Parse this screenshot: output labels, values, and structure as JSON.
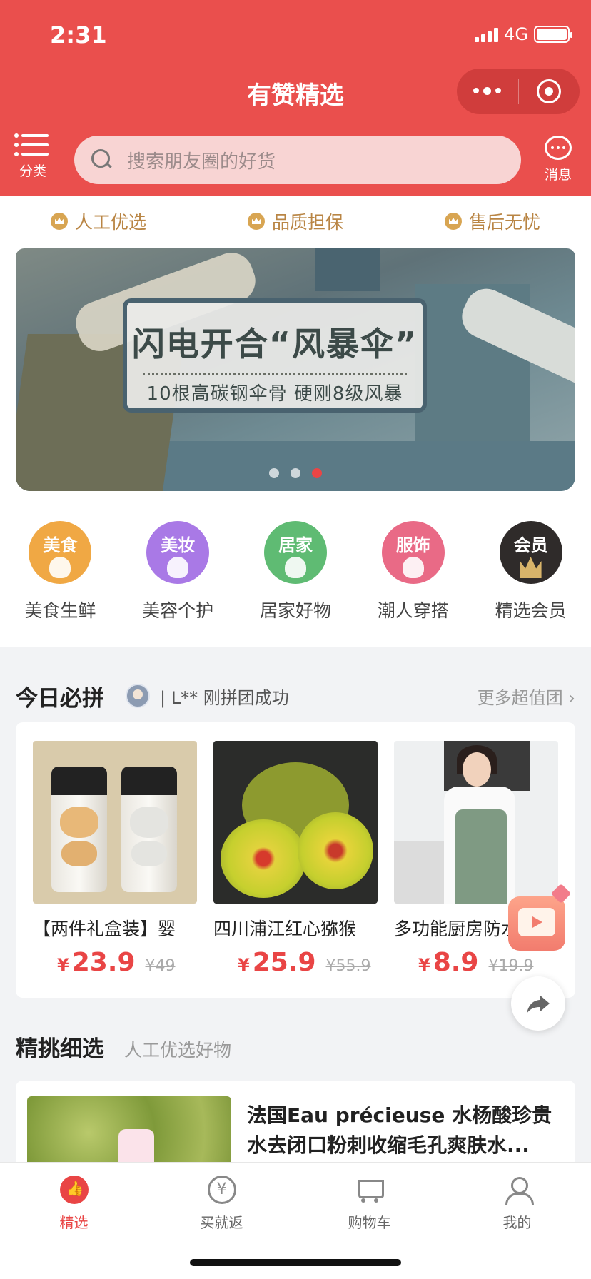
{
  "status": {
    "time": "2:31",
    "network": "4G"
  },
  "header": {
    "title": "有赞精选"
  },
  "toolbar": {
    "category_label": "分类",
    "search_placeholder": "搜索朋友圈的好货",
    "message_label": "消息"
  },
  "guarantees": [
    "人工优选",
    "品质担保",
    "售后无忧"
  ],
  "banner": {
    "headline": "闪电开合“风暴伞”",
    "subline": "10根高碳钢伞骨 硬刚8级风暴",
    "active_dot": 3,
    "dot_count": 3
  },
  "categories": [
    {
      "badge": "美食",
      "name": "美食生鲜",
      "color": "#f0a844"
    },
    {
      "badge": "美妆",
      "name": "美容个护",
      "color": "#a979e6"
    },
    {
      "badge": "居家",
      "name": "居家好物",
      "color": "#5fbb73"
    },
    {
      "badge": "服饰",
      "name": "潮人穿搭",
      "color": "#e96a86"
    },
    {
      "badge": "会员",
      "name": "精选会员",
      "color": "#2f2b2a"
    }
  ],
  "today": {
    "title": "今日必拼",
    "news": "| L** 刚拼团成功",
    "more": "更多超值团",
    "products": [
      {
        "name": "【两件礼盒装】婴",
        "currency": "¥",
        "price": "23.9",
        "was": "¥49"
      },
      {
        "name": "四川浦江红心猕猴",
        "currency": "¥",
        "price": "25.9",
        "was": "¥55.9"
      },
      {
        "name": "多功能厨房防水",
        "currency": "¥",
        "price": "8.9",
        "was": "¥19.9"
      }
    ]
  },
  "featured": {
    "title": "精挑细选",
    "subtitle": "人工优选好物",
    "item_title": "法国Eau précieuse 水杨酸珍贵水去闭口粉刺收缩毛孔爽肤水..."
  },
  "tabbar": [
    {
      "label": "精选",
      "icon": "thumbs-up-icon",
      "active": true
    },
    {
      "label": "买就返",
      "icon": "yuan-icon",
      "active": false
    },
    {
      "label": "购物车",
      "icon": "cart-icon",
      "active": false
    },
    {
      "label": "我的",
      "icon": "user-icon",
      "active": false
    }
  ],
  "colors": {
    "brand": "#ea4f4d",
    "price": "#e94545",
    "gold": "#b98544"
  }
}
